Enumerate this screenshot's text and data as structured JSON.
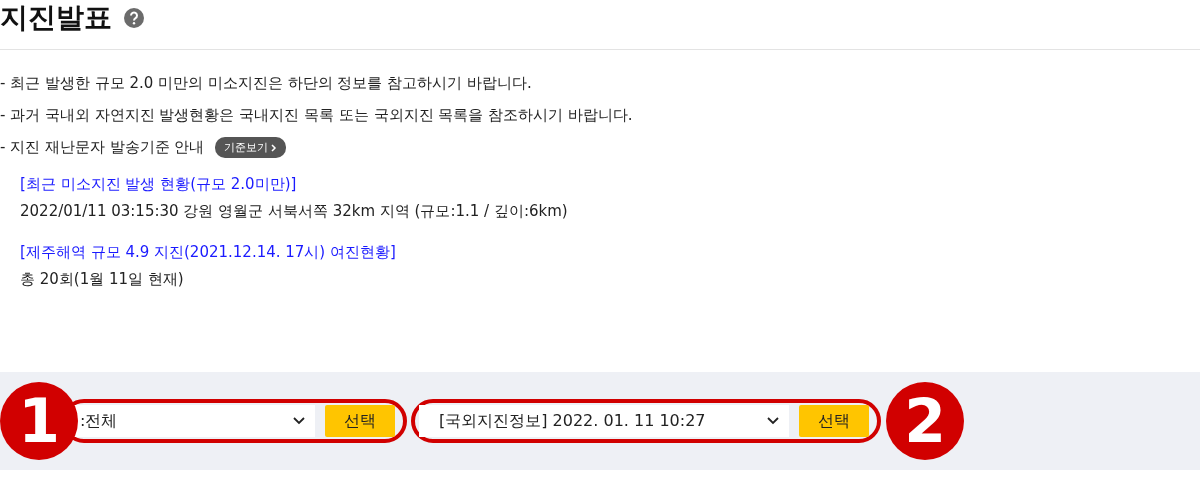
{
  "header": {
    "title": "지진발표"
  },
  "notes": [
    {
      "text": "- 최근 발생한 규모 2.0 미만의 미소지진은 하단의 정보를 참고하시기 바랍니다."
    },
    {
      "text": "- 과거 국내외 자연지진 발생현황은 국내지진 목록 또는 국외지진 목록을 참조하시기 바랍니다."
    },
    {
      "text": "- 지진 재난문자 발송기준 안내",
      "button": "기준보기"
    }
  ],
  "reports": [
    {
      "link": "[최근 미소지진 발생 현황(규모 2.0미만)]",
      "detail": "2022/01/11 03:15:30 강원 영월군 서북서쪽 32km 지역 (규모:1.1 / 깊이:6km)"
    },
    {
      "link": "[제주해역 규모 4.9 지진(2021.12.14. 17시) 여진현황]",
      "detail": "총 20회(1월 11일 현재)"
    }
  ],
  "selectors": [
    {
      "badge": "1",
      "value": ":전체",
      "button": "선택"
    },
    {
      "badge": "2",
      "value": "[국외지진정보] 2022. 01. 11 10:27",
      "button": "선택"
    }
  ]
}
